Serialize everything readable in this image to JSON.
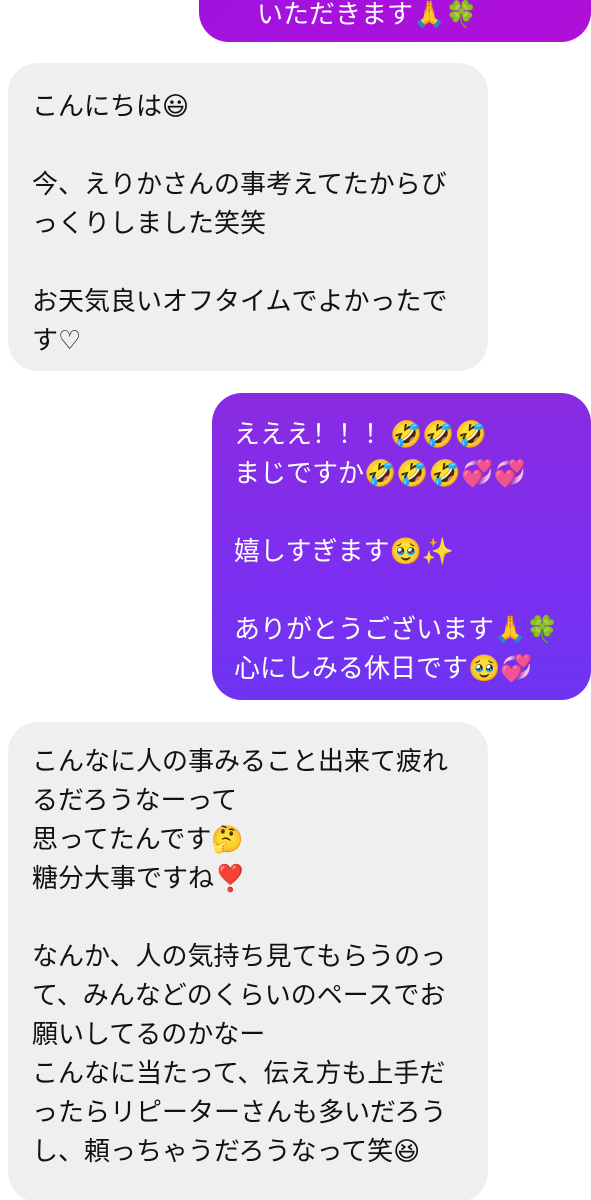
{
  "messages": [
    {
      "direction": "sent",
      "lines": [
        "いただきます🙏🍀"
      ]
    },
    {
      "direction": "received",
      "lines": [
        "こんにちは😃",
        "",
        "今、えりかさんの事考えてたからび",
        "っくりしました笑笑",
        "",
        "お天気良いオフタイムでよかったで",
        "す♡"
      ]
    },
    {
      "direction": "sent",
      "lines": [
        "えええ！！！🤣🤣🤣",
        "まじですか🤣🤣🤣💞💞",
        "",
        "嬉しすぎます🥹✨",
        "",
        "ありがとうございます🙏🍀",
        "心にしみる休日です🥹💞"
      ]
    },
    {
      "direction": "received",
      "lines": [
        "こんなに人の事みること出来て疲れ",
        "るだろうなーって",
        "思ってたんです🤔",
        "糖分大事ですね❣️",
        "",
        "なんか、人の気持ち見てもらうのっ",
        "て、みんなどのくらいのペースでお",
        "願いしてるのかなー",
        "こんなに当たって、伝え方も上手だ",
        "ったらリピーターさんも多いだろう",
        "し、頼っちゃうだろうなって笑😆"
      ]
    }
  ],
  "colors": {
    "received_bubble": "#efefef",
    "sent_bubble_top": "#8a2be2",
    "sent_bubble_bottom": "#6e34f2",
    "sent_bubble_prev": "#a012e0",
    "text_dark": "#111111",
    "text_light": "#ffffff"
  }
}
